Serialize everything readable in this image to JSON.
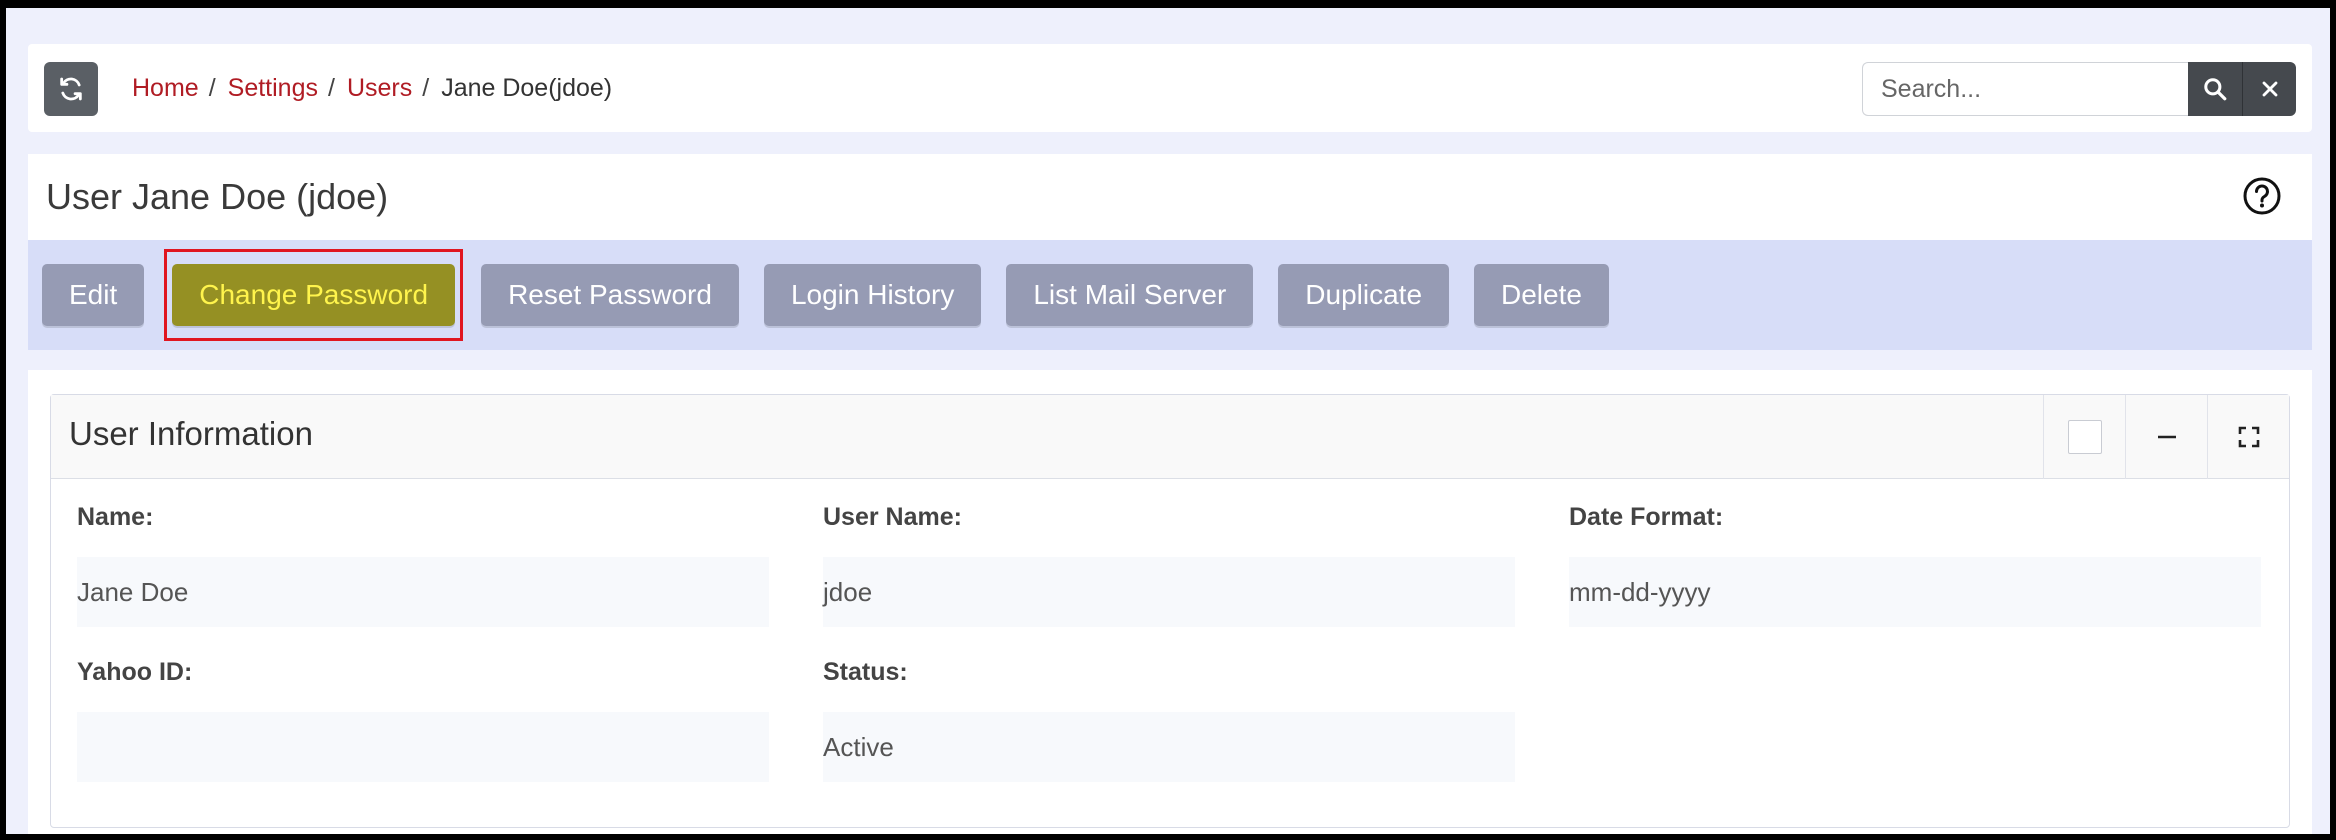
{
  "breadcrumb": {
    "items": [
      "Home",
      "Settings",
      "Users"
    ],
    "separator": "/",
    "current": "Jane Doe(jdoe)"
  },
  "search": {
    "placeholder": "Search..."
  },
  "header": {
    "title": "User Jane Doe (jdoe)"
  },
  "actions": {
    "edit": "Edit",
    "change_password": "Change Password",
    "reset_password": "Reset Password",
    "login_history": "Login History",
    "list_mail_server": "List Mail Server",
    "duplicate": "Duplicate",
    "delete": "Delete"
  },
  "user_info": {
    "title": "User Information",
    "fields": [
      {
        "label": "Name:",
        "value": "Jane Doe"
      },
      {
        "label": "User Name:",
        "value": "jdoe"
      },
      {
        "label": "Date Format:",
        "value": "mm-dd-yyyy"
      },
      {
        "label": "Yahoo ID:",
        "value": ""
      },
      {
        "label": "Status:",
        "value": "Active"
      }
    ]
  },
  "colors": {
    "link": "#b01c24",
    "action_bar": "#d7ddf8",
    "button": "#969bb4",
    "highlight_button": "#959023",
    "highlight_text": "#fff44c",
    "highlight_border": "#e01520"
  }
}
